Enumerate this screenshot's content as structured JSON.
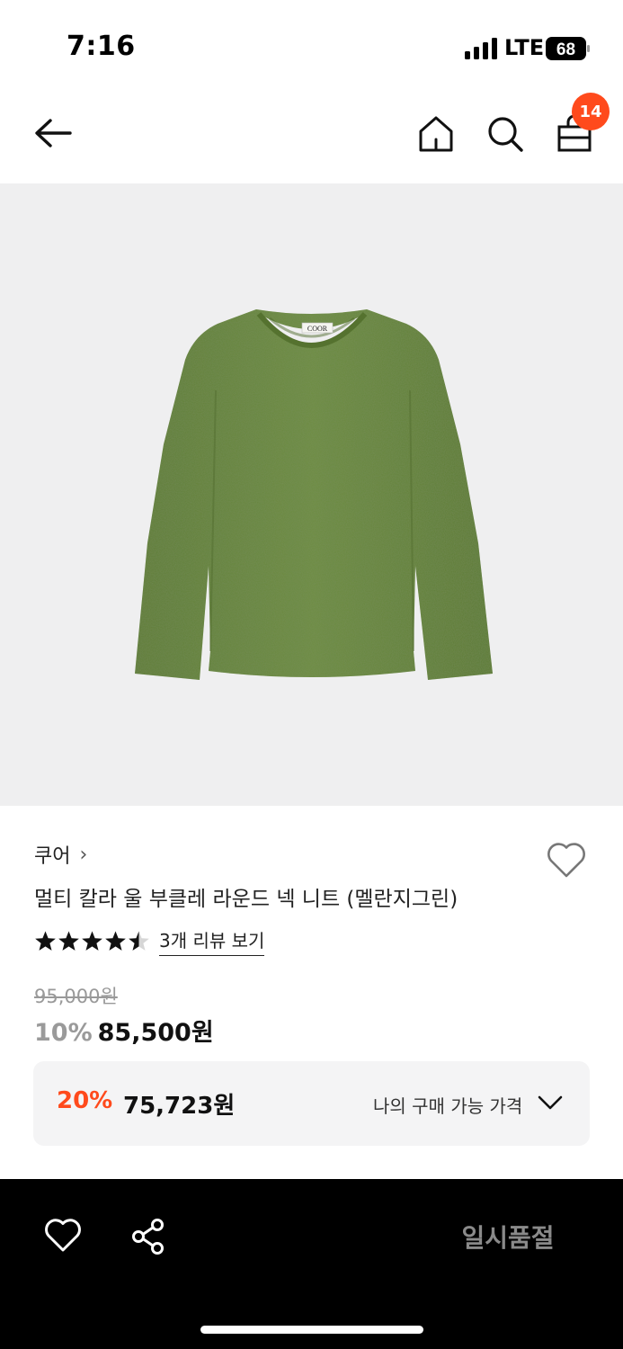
{
  "status_bar": {
    "time": "7:16",
    "network": "LTE",
    "battery": "68"
  },
  "nav": {
    "cart_count": "14",
    "icons": [
      "back-arrow-icon",
      "home-icon",
      "search-icon",
      "shopping-bag-icon"
    ]
  },
  "product": {
    "brand": "쿠어",
    "brand_chevron": "›",
    "title": "멀티 칼라 울 부클레 라운드 넥 니트 (멜란지그린)",
    "label_text": "COOR",
    "rating": 4.5,
    "review_link": "3개 리뷰 보기",
    "original_price": "95,000원",
    "discount_percent": "10%",
    "sale_price": "85,500원"
  },
  "my_price": {
    "percent": "20%",
    "price": "75,723원",
    "label": "나의 구매 가능 가격"
  },
  "bottom_bar": {
    "status_button": "일시품절"
  },
  "colors": {
    "accent": "#ff4a1c",
    "sweater": "#6a8a3e",
    "image_bg": "#efeff0"
  }
}
